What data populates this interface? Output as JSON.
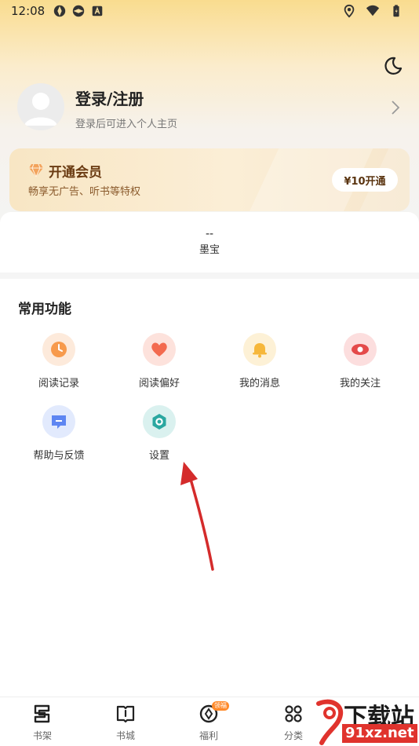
{
  "status_bar": {
    "time": "12:08"
  },
  "profile": {
    "title": "登录/注册",
    "subtitle": "登录后可进入个人主页"
  },
  "vip": {
    "title": "开通会员",
    "subtitle": "畅享无广告、听书等特权",
    "button": "¥10开通"
  },
  "stats": {
    "value": "--",
    "label": "墨宝"
  },
  "functions": {
    "title": "常用功能",
    "items": [
      {
        "label": "阅读记录",
        "icon": "clock-icon",
        "color": "#f79a4c"
      },
      {
        "label": "阅读偏好",
        "icon": "heart-icon",
        "color": "#f36a4f"
      },
      {
        "label": "我的消息",
        "icon": "bell-icon",
        "color": "#f6b73a"
      },
      {
        "label": "我的关注",
        "icon": "eye-icon",
        "color": "#e44a4a"
      },
      {
        "label": "帮助与反馈",
        "icon": "chat-icon",
        "color": "#5e86f2"
      },
      {
        "label": "设置",
        "icon": "gear-icon",
        "color": "#2aa7a0"
      }
    ]
  },
  "tabbar": {
    "items": [
      {
        "label": "书架"
      },
      {
        "label": "书城"
      },
      {
        "label": "福利",
        "badge": "领福"
      },
      {
        "label": "分类"
      }
    ]
  },
  "watermark": {
    "top": "下载站",
    "bottom": "91xz.net"
  }
}
